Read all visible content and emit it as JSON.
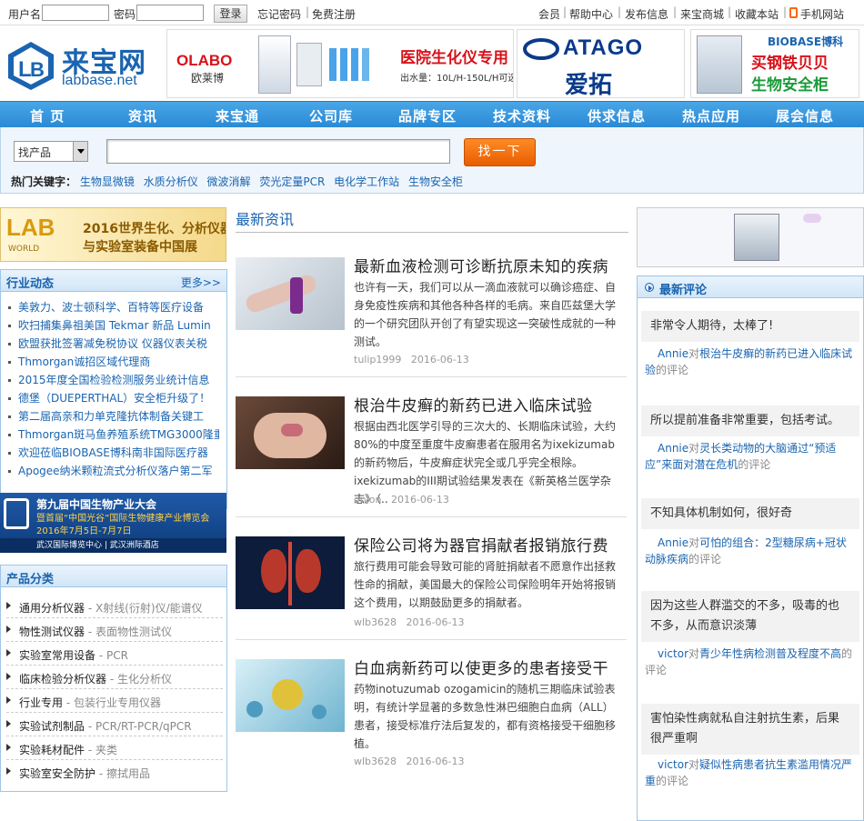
{
  "topbar": {
    "username_label": "用户名",
    "password_label": "密码",
    "login_button": "登录",
    "forgot_password": "忘记密码",
    "free_register": "免费注册",
    "links": [
      "会员",
      "帮助中心",
      "发布信息",
      "来宝商城",
      "收藏本站",
      "手机网站"
    ]
  },
  "logo": {
    "cn": "来宝网",
    "en": "labbase.net"
  },
  "ads": [
    {
      "brand": "OLABO",
      "brand_cn": "欧莱博",
      "text": "医院生化仪专用",
      "sub": "出水量：10L/H-150L/H可选"
    },
    {
      "brand": "ATAGO",
      "brand_cn": "爱拓"
    },
    {
      "brand": "BIOBASE博科",
      "text1": "买钢铁贝贝",
      "text2": "生物安全柜"
    }
  ],
  "nav": [
    "首 页",
    "资讯",
    "来宝通",
    "公司库",
    "品牌专区",
    "技术资料",
    "供求信息",
    "热点应用",
    "展会信息"
  ],
  "search": {
    "select_value": "找产品",
    "button": "找一下",
    "hot_label": "热门关键字：",
    "hot_keywords": [
      "生物显微镜",
      "水质分析仪",
      "微波消解",
      "荧光定量PCR",
      "电化学工作站",
      "生物安全柜"
    ]
  },
  "left": {
    "banner_top": {
      "brand": "LAB",
      "world": "WORLD",
      "text1": "2016世界生化、分析仪器",
      "text2": "与实验室装备中国展"
    },
    "industry": {
      "title": "行业动态",
      "more": "更多>>",
      "items": [
        "美敦力、波士顿科学、百特等医疗设备",
        "吹扫捕集鼻祖美国 Tekmar 新品 Lumin",
        "欧盟获批签署减免税协议 仪器仪表关税",
        "Thmorgan诚招区域代理商",
        "2015年度全国检验检测服务业统计信息",
        "德堡（DUEPERTHAL）安全柜升级了！",
        "第二届高亲和力单克隆抗体制备关键工",
        "Thmorgan斑马鱼养殖系统TMG3000隆重",
        "欢迎莅临BIOBASE博科南非国际医疗器",
        "Apogee纳米颗粒流式分析仪落户第二军"
      ]
    },
    "banner_mid": {
      "t1": "第九届中国生物产业大会",
      "t2": "暨首届“中国光谷”国际生物健康产业博览会",
      "t3": "2016年7月5日-7月7日",
      "t4": "武汉国际博览中心 | 武汉洲际酒店"
    },
    "categories": {
      "title": "产品分类",
      "items": [
        {
          "main": "通用分析仪器",
          "sub": "- X射线(衍射)仪/能谱仪"
        },
        {
          "main": "物性测试仪器",
          "sub": "- 表面物性测试仪"
        },
        {
          "main": "实验室常用设备",
          "sub": "- PCR"
        },
        {
          "main": "临床检验分析仪器",
          "sub": "- 生化分析仪"
        },
        {
          "main": "行业专用",
          "sub": "- 包装行业专用仪器"
        },
        {
          "main": "实验试剂制品",
          "sub": "- PCR/RT-PCR/qPCR"
        },
        {
          "main": "实验耗材配件",
          "sub": "- 夹类"
        },
        {
          "main": "实验室安全防护",
          "sub": "- 擦拭用品"
        }
      ]
    }
  },
  "center": {
    "title": "最新资讯",
    "articles": [
      {
        "title": "最新血液检测可诊断抗原未知的疾病",
        "summary": "也许有一天，我们可以从一滴血液就可以确诊癌症、自身免疫性疾病和其他各种各样的毛病。来自匹兹堡大学的一个研究团队开创了有望实现这一突破性成就的一种测试。",
        "author": "tulip1999",
        "date": "2016-06-13"
      },
      {
        "title": "根治牛皮癣的新药已进入临床试验",
        "summary": "根据由西北医学引导的三次大的、长期临床试验，大约80%的中度至重度牛皮癣患者在服用名为ixekizumab的新药物后，牛皮癣症状完全或几乎完全根除。ixekizumab的III期试验结果发表在《新英格兰医学杂志》（..",
        "author": "onion",
        "date": "2016-06-13"
      },
      {
        "title": "保险公司将为器官捐献者报销旅行费",
        "summary": "旅行费用可能会导致可能的肾脏捐献者不愿意作出拯救性命的捐献，美国最大的保险公司保险明年开始将报销这个费用，以期鼓励更多的捐献者。",
        "author": "wlb3628",
        "date": "2016-06-13"
      },
      {
        "title": "白血病新药可以使更多的患者接受干",
        "summary": "药物inotuzumab ozogamicin的随机三期临床试验表明，有统计学显著的多数急性淋巴细胞白血病（ALL）患者，接受标准疗法后复发的，都有资格接受干细胞移植。",
        "author": "wlb3628",
        "date": "2016-06-13"
      }
    ]
  },
  "right": {
    "comments_title": "最新评论",
    "comments": [
      {
        "quote": "非常令人期待，太棒了!",
        "user": "Annie",
        "dui": "对",
        "link": "根治牛皮癣的新药已进入临床试验",
        "suffix": "的评论"
      },
      {
        "quote": "所以提前准备非常重要，包括考试。",
        "user": "Annie",
        "dui": "对",
        "link": "灵长类动物的大脑通过“预适应”来面对潜在危机",
        "suffix": "的评论"
      },
      {
        "quote": "不知具体机制如何，很好奇",
        "user": "Annie",
        "dui": "对",
        "link": "可怕的组合：2型糖尿病+冠状动脉疾病",
        "suffix": "的评论"
      },
      {
        "quote": "因为这些人群滥交的不多，吸毒的也不多，从而意识淡薄",
        "user": "victor",
        "dui": "对",
        "link": "青少年性病检测普及程度不高",
        "suffix": "的评论"
      },
      {
        "quote": "害怕染性病就私自注射抗生素，后果很严重啊",
        "user": "victor",
        "dui": "对",
        "link": "疑似性病患者抗生素滥用情况严重",
        "suffix": "的评论"
      }
    ]
  },
  "colors": {
    "brand_blue": "#1a64b0",
    "nav_blue": "#2a8ad6",
    "orange": "#ff7a1a"
  }
}
